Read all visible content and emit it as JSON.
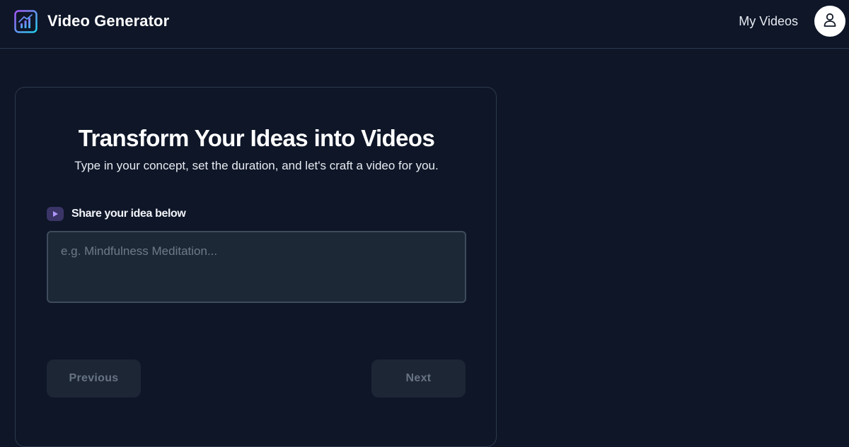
{
  "header": {
    "app_title": "Video Generator",
    "nav_link": "My Videos",
    "logo_icon": "analytics-logo-icon",
    "avatar_icon": "user-icon"
  },
  "main": {
    "headline": "Transform Your Ideas into Videos",
    "subheadline": "Type in your concept, set the duration, and let's craft a video for you.",
    "idea_label": "Share your idea below",
    "idea_label_icon": "play-icon",
    "idea_input": {
      "value": "",
      "placeholder": "e.g. Mindfulness Meditation..."
    },
    "previous_label": "Previous",
    "next_label": "Next"
  },
  "colors": {
    "background": "#0e1628",
    "accent": "#8b5cf6",
    "accent_secondary": "#22d3ee",
    "button_bg": "#1c2634",
    "button_text": "#677384"
  }
}
